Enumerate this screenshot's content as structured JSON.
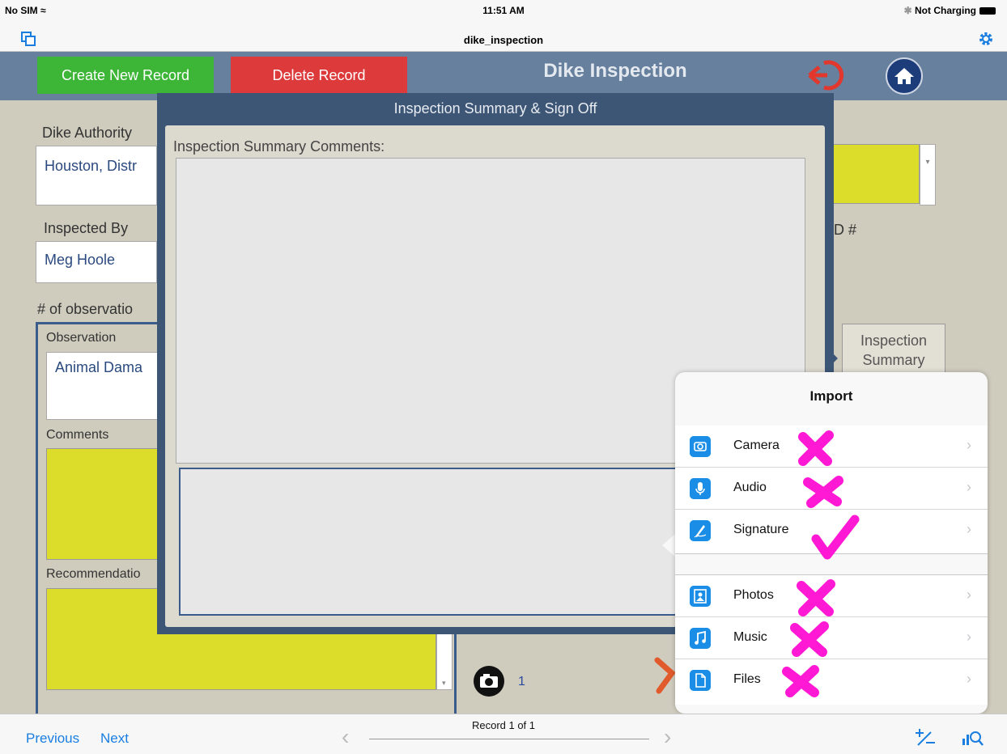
{
  "status_bar": {
    "carrier": "No SIM",
    "time": "11:51 AM",
    "battery": "Not Charging"
  },
  "title_bar": {
    "title": "dike_inspection"
  },
  "header": {
    "create_button": "Create New Record",
    "delete_button": "Delete Record",
    "title": "Dike Inspection"
  },
  "form": {
    "dike_authority_label": "Dike Authority",
    "dike_authority_value": "Houston, Distr",
    "inspected_by_label": "Inspected By",
    "inspected_by_value": "Meg Hoole",
    "id_label": "D #",
    "observations_label": "# of observatio",
    "observation_label": "Observation",
    "observation_value": "Animal Dama",
    "comments_label": "Comments",
    "recommendation_label": "Recommendatio",
    "photo_count": "1",
    "inspection_summary_button": "Inspection Summary",
    "field_highlight_color": "#dcdc2a"
  },
  "modal": {
    "title": "Inspection Summary & Sign Off",
    "comments_label": "Inspection Summary Comments:"
  },
  "import_popover": {
    "title": "Import",
    "group1": [
      {
        "label": "Camera",
        "icon": "camera-icon",
        "mark": "cross"
      },
      {
        "label": "Audio",
        "icon": "microphone-icon",
        "mark": "cross"
      },
      {
        "label": "Signature",
        "icon": "signature-icon",
        "mark": "check"
      }
    ],
    "group2": [
      {
        "label": "Photos",
        "icon": "photos-icon",
        "mark": "cross"
      },
      {
        "label": "Music",
        "icon": "music-icon",
        "mark": "cross"
      },
      {
        "label": "Files",
        "icon": "file-icon",
        "mark": "cross"
      }
    ],
    "mark_color": "#ff19d4",
    "icon_color": "#1a8ee6"
  },
  "bottom_bar": {
    "previous": "Previous",
    "next": "Next",
    "record_counter": "Record 1 of 1"
  }
}
